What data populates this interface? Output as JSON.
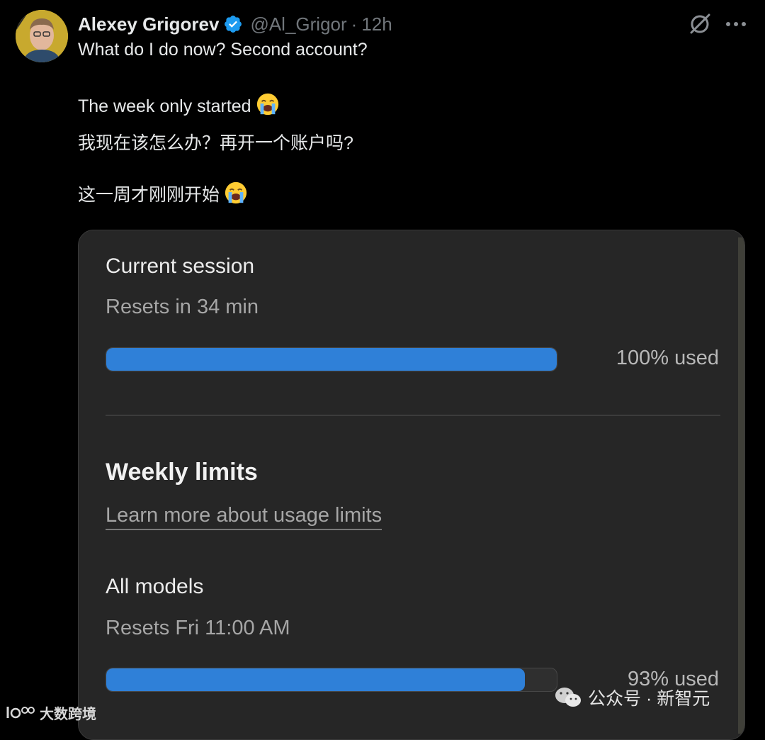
{
  "tweet": {
    "author_name": "Alexey Grigorev",
    "handle": "@Al_Grigor",
    "separator": "·",
    "time": "12h",
    "line1": "What do I do now? Second account?",
    "line2": "The week only started",
    "line3": "我现在该怎么办？再开一个账户吗?",
    "line4": "这一周才刚刚开始",
    "emoji": "loudly-crying-face"
  },
  "usage_card": {
    "session": {
      "title": "Current session",
      "reset_text": "Resets in 34 min",
      "used_label": "100% used",
      "used_fraction": 1.0
    },
    "weekly": {
      "heading": "Weekly limits",
      "link_text": "Learn more about usage limits"
    },
    "all_models": {
      "title": "All models",
      "reset_text": "Resets Fri 11:00 AM",
      "used_label": "93% used",
      "used_fraction": 0.93
    }
  },
  "watermarks": {
    "left_text": "大数跨境",
    "right_text": "公众号 · 新智元"
  },
  "colors": {
    "accent_bar": "#2f80d8",
    "verified": "#1d9bf0"
  }
}
